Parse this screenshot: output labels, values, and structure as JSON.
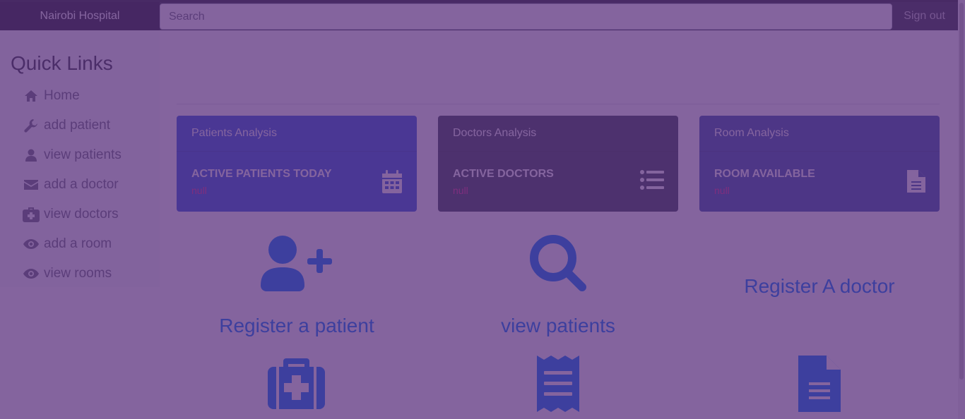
{
  "navbar": {
    "brand": "Nairobi Hospital",
    "search_placeholder": "Search",
    "signout_label": "Sign out"
  },
  "sidebar": {
    "title": "Quick Links",
    "items": [
      {
        "label": "Home",
        "icon": "home-icon"
      },
      {
        "label": "add patient",
        "icon": "wrench-icon"
      },
      {
        "label": "view patients",
        "icon": "user-icon"
      },
      {
        "label": "add a doctor",
        "icon": "envelope-icon"
      },
      {
        "label": "view doctors",
        "icon": "medkit-icon"
      },
      {
        "label": "add a room",
        "icon": "eye-icon"
      },
      {
        "label": "view rooms",
        "icon": "eye-icon"
      }
    ]
  },
  "cards": [
    {
      "header": "Patients Analysis",
      "metric": "ACTIVE PATIENTS TODAY",
      "value": "null",
      "icon": "calendar-icon",
      "color": "#2f5fdc"
    },
    {
      "header": "Doctors Analysis",
      "metric": "ACTIVE DOCTORS",
      "value": "null",
      "icon": "list-icon",
      "color": "#3c4955"
    },
    {
      "header": "Room Analysis",
      "metric": "ROOM AVAILABLE",
      "value": "null",
      "icon": "file-icon",
      "color": "#3b5aa8"
    }
  ],
  "links": {
    "register_patient": "Register a patient",
    "view_patients": "view patients",
    "register_doctor": "Register A doctor"
  },
  "colors": {
    "overlay": "#542878",
    "link": "#007bff",
    "navbar": "#343a40"
  }
}
